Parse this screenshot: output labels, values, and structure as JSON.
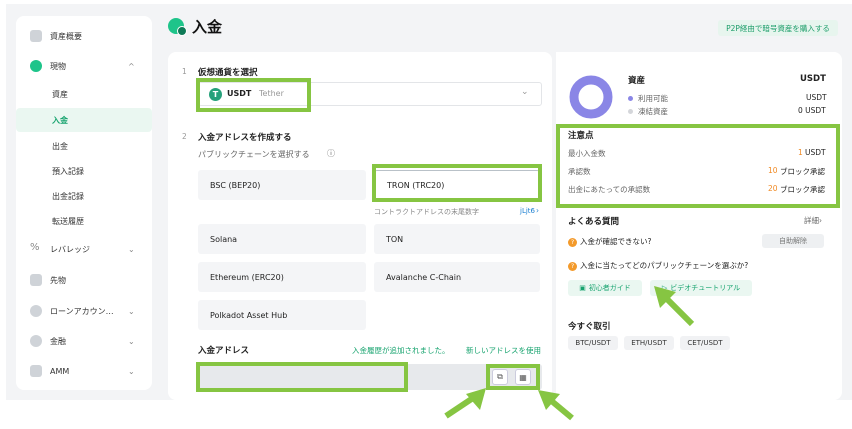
{
  "header": {
    "title": "入金",
    "p2p_button": "P2P経由で暗号資産を購入する"
  },
  "sidebar": {
    "items": [
      {
        "label": "資産概要"
      },
      {
        "label": "現物",
        "chevron": "^"
      },
      {
        "label": "資産"
      },
      {
        "label": "入金"
      },
      {
        "label": "出金"
      },
      {
        "label": "預入記録"
      },
      {
        "label": "出金記録"
      },
      {
        "label": "転送履歴"
      },
      {
        "label": "レバレッジ",
        "chevron": "⌄"
      },
      {
        "label": "先物"
      },
      {
        "label": "ローンアカウン…",
        "chevron": "⌄"
      },
      {
        "label": "金融",
        "chevron": "⌄"
      },
      {
        "label": "AMM",
        "chevron": "⌄"
      }
    ]
  },
  "step1": {
    "num": "1",
    "title": "仮想通貨を選択",
    "coin_symbol": "USDT",
    "coin_name": "Tether",
    "coin_icon": "T",
    "chevron": "⌄"
  },
  "step2": {
    "num": "2",
    "title": "入金アドレスを作成する",
    "chain_prompt": "パブリックチェーンを選択する",
    "info_icon": "ⓘ",
    "chains": [
      "BSC (BEP20)",
      "TRON (TRC20)",
      "Solana",
      "TON",
      "Ethereum (ERC20)",
      "Avalanche C-Chain",
      "Polkadot Asset Hub"
    ],
    "contract_note": "コントラクトアドレスの末尾数字",
    "contract_suffix": "jLjt6",
    "contract_arrow": "›"
  },
  "address": {
    "label": "入金アドレス",
    "notice": "入金履歴が追加されました。",
    "new_address": "新しいアドレスを使用",
    "copy_icon": "⧉",
    "qr_icon": "▦"
  },
  "assets": {
    "title": "資産",
    "currency": "USDT",
    "available_label": "利用可能",
    "available_value": "USDT",
    "frozen_label": "凍結資産",
    "frozen_value": "0 USDT"
  },
  "notes": {
    "title": "注意点",
    "min_label": "最小入金数",
    "min_value": "1",
    "min_unit": "USDT",
    "confirm_label": "承認数",
    "confirm_value": "10",
    "confirm_unit": "ブロック承認",
    "withdraw_label": "出金にあたっての承認数",
    "withdraw_value": "20",
    "withdraw_unit": "ブロック承認"
  },
  "faq": {
    "title": "よくある質問",
    "more": "詳細›",
    "q1": "入金が確認できない?",
    "q1_button": "自助解除",
    "q2": "入金に当たってどのパブリックチェーンを選ぶか?",
    "q_icon": "?",
    "guide": "初心者ガイド",
    "guide_icon": "▣",
    "video": "ビデオチュートリアル",
    "video_icon": "▷"
  },
  "trade": {
    "title": "今すぐ取引",
    "pairs": [
      "BTC/USDT",
      "ETH/USDT",
      "CET/USDT"
    ]
  },
  "colors": {
    "accent": "#16a36e",
    "highlight": "#86c542",
    "warning": "#f08a24",
    "ring": "#8a86e6"
  }
}
